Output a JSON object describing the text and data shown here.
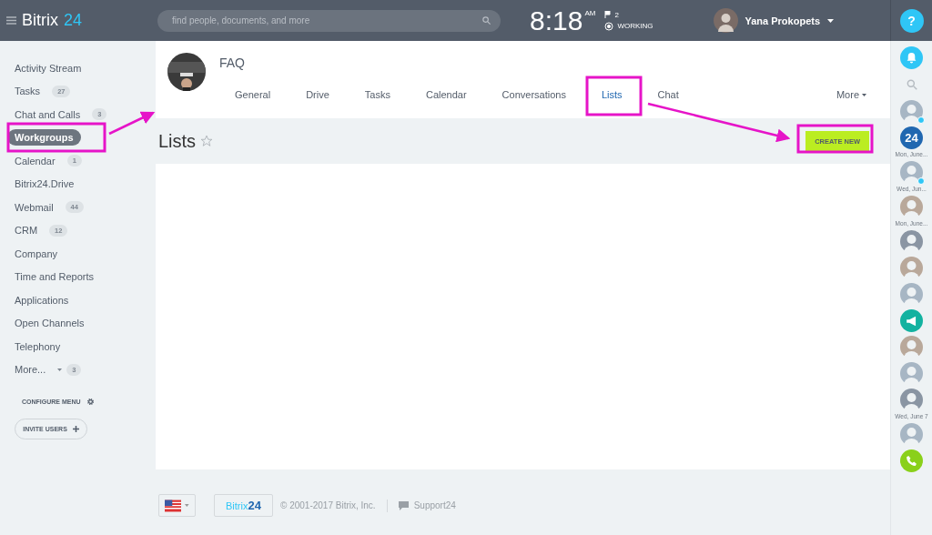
{
  "header": {
    "logo_main": "Bitrix",
    "logo_accent": "24",
    "search": {
      "placeholder": "find people, documents, and more"
    },
    "time": "8:18",
    "ampm": "AM",
    "flags": "2",
    "status": "WORKING",
    "user": "Yana Prokopets",
    "help": "?"
  },
  "sidebar": {
    "items": [
      {
        "label": "Activity Stream",
        "selected": false
      },
      {
        "label": "Tasks",
        "count": "27",
        "selected": false
      },
      {
        "label": "Chat and Calls",
        "count": "3",
        "selected": false
      },
      {
        "label": "Workgroups",
        "selected": true
      },
      {
        "label": "Calendar",
        "count": "1",
        "selected": false
      },
      {
        "label": "Bitrix24.Drive",
        "selected": false
      },
      {
        "label": "Webmail",
        "count": "44",
        "selected": false
      },
      {
        "label": "CRM",
        "count": "12",
        "selected": false
      },
      {
        "label": "Company",
        "selected": false
      },
      {
        "label": "Time and Reports",
        "selected": false
      },
      {
        "label": "Applications",
        "selected": false
      },
      {
        "label": "Open Channels",
        "selected": false
      },
      {
        "label": "Telephony",
        "selected": false
      },
      {
        "label": "More...",
        "count": "3",
        "selected": false,
        "dropdown": true
      }
    ],
    "configure": "CONFIGURE MENU",
    "invite": "INVITE USERS"
  },
  "group": {
    "name": "FAQ",
    "tabs": [
      {
        "label": "General",
        "selected": false
      },
      {
        "label": "Drive",
        "selected": false
      },
      {
        "label": "Tasks",
        "selected": false
      },
      {
        "label": "Calendar",
        "selected": false
      },
      {
        "label": "Conversations",
        "selected": false
      },
      {
        "label": "Lists",
        "selected": true
      },
      {
        "label": "Chat",
        "selected": false
      }
    ],
    "more": "More"
  },
  "page": {
    "title": "Lists",
    "create_button": "CREATE NEW"
  },
  "footer": {
    "logo_main": "Bitrix",
    "logo_accent": "24",
    "copyright": "© 2001-2017 Bitrix, Inc.",
    "support": "Support24"
  },
  "right_bar": [
    {
      "kind": "bell"
    },
    {
      "kind": "search"
    },
    {
      "kind": "avatar",
      "badge": true
    },
    {
      "kind": "logo",
      "text": "24"
    },
    {
      "kind": "label",
      "text": "Mon, June..."
    },
    {
      "kind": "avatar",
      "badge": true
    },
    {
      "kind": "label",
      "text": "Wed, Jun..."
    },
    {
      "kind": "avatar"
    },
    {
      "kind": "label",
      "text": "Mon, June..."
    },
    {
      "kind": "avatar"
    },
    {
      "kind": "avatar"
    },
    {
      "kind": "avatar"
    },
    {
      "kind": "megaphone"
    },
    {
      "kind": "avatar"
    },
    {
      "kind": "avatar"
    },
    {
      "kind": "avatar"
    },
    {
      "kind": "label",
      "text": "Wed, June 7"
    },
    {
      "kind": "avatar"
    },
    {
      "kind": "phone"
    }
  ]
}
